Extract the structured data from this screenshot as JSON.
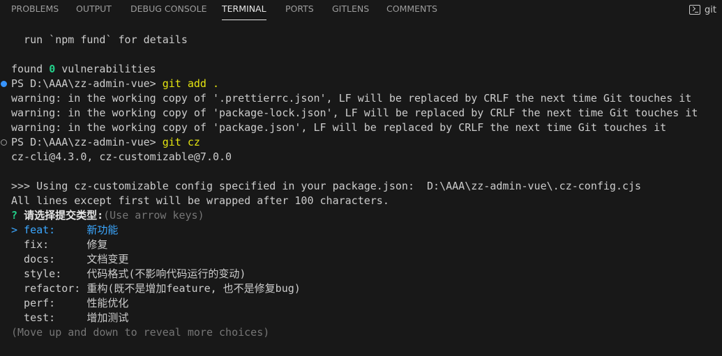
{
  "tabs": [
    {
      "label": "PROBLEMS",
      "active": false
    },
    {
      "label": "OUTPUT",
      "active": false
    },
    {
      "label": "DEBUG CONSOLE",
      "active": false
    },
    {
      "label": "TERMINAL",
      "active": true
    },
    {
      "label": "PORTS",
      "active": false
    },
    {
      "label": "GITLENS",
      "active": false
    },
    {
      "label": "COMMENTS",
      "active": false
    }
  ],
  "terminal_instance": {
    "icon": "terminal-icon",
    "label": "git"
  },
  "colors": {
    "background": "#181818",
    "prompt_command": "#e5e510",
    "count": "#23d18b",
    "selected": "#3ba7ff",
    "hint": "#767676"
  },
  "lines": {
    "fund": "  run `npm fund` for details",
    "found_prefix": "found ",
    "found_count": "0",
    "found_suffix": " vulnerabilities",
    "prompt1": "PS D:\\AAA\\zz-admin-vue> ",
    "cmd1": "git add .",
    "warn1": "warning: in the working copy of '.prettierrc.json', LF will be replaced by CRLF the next time Git touches it",
    "warn2": "warning: in the working copy of 'package-lock.json', LF will be replaced by CRLF the next time Git touches it",
    "warn3": "warning: in the working copy of 'package.json', LF will be replaced by CRLF the next time Git touches it",
    "prompt2": "PS D:\\AAA\\zz-admin-vue> ",
    "cmd2": "git cz",
    "versions": "cz-cli@4.3.0, cz-customizable@7.0.0",
    "using": ">>> Using cz-customizable config specified in your package.json:  D:\\AAA\\zz-admin-vue\\.cz-config.cjs",
    "wrap": "All lines except first will be wrapped after 100 characters.",
    "question_mark": "? ",
    "question": "请选择提交类型:",
    "question_hint": "(Use arrow keys)",
    "more": "(Move up and down to reveal more choices)"
  },
  "choices": [
    {
      "text": "> feat:     新功能",
      "selected": true
    },
    {
      "text": "  fix:      修复",
      "selected": false
    },
    {
      "text": "  docs:     文档变更",
      "selected": false
    },
    {
      "text": "  style:    代码格式(不影响代码运行的变动)",
      "selected": false
    },
    {
      "text": "  refactor: 重构(既不是增加feature, 也不是修复bug)",
      "selected": false
    },
    {
      "text": "  perf:     性能优化",
      "selected": false
    },
    {
      "text": "  test:     增加测试",
      "selected": false
    }
  ]
}
